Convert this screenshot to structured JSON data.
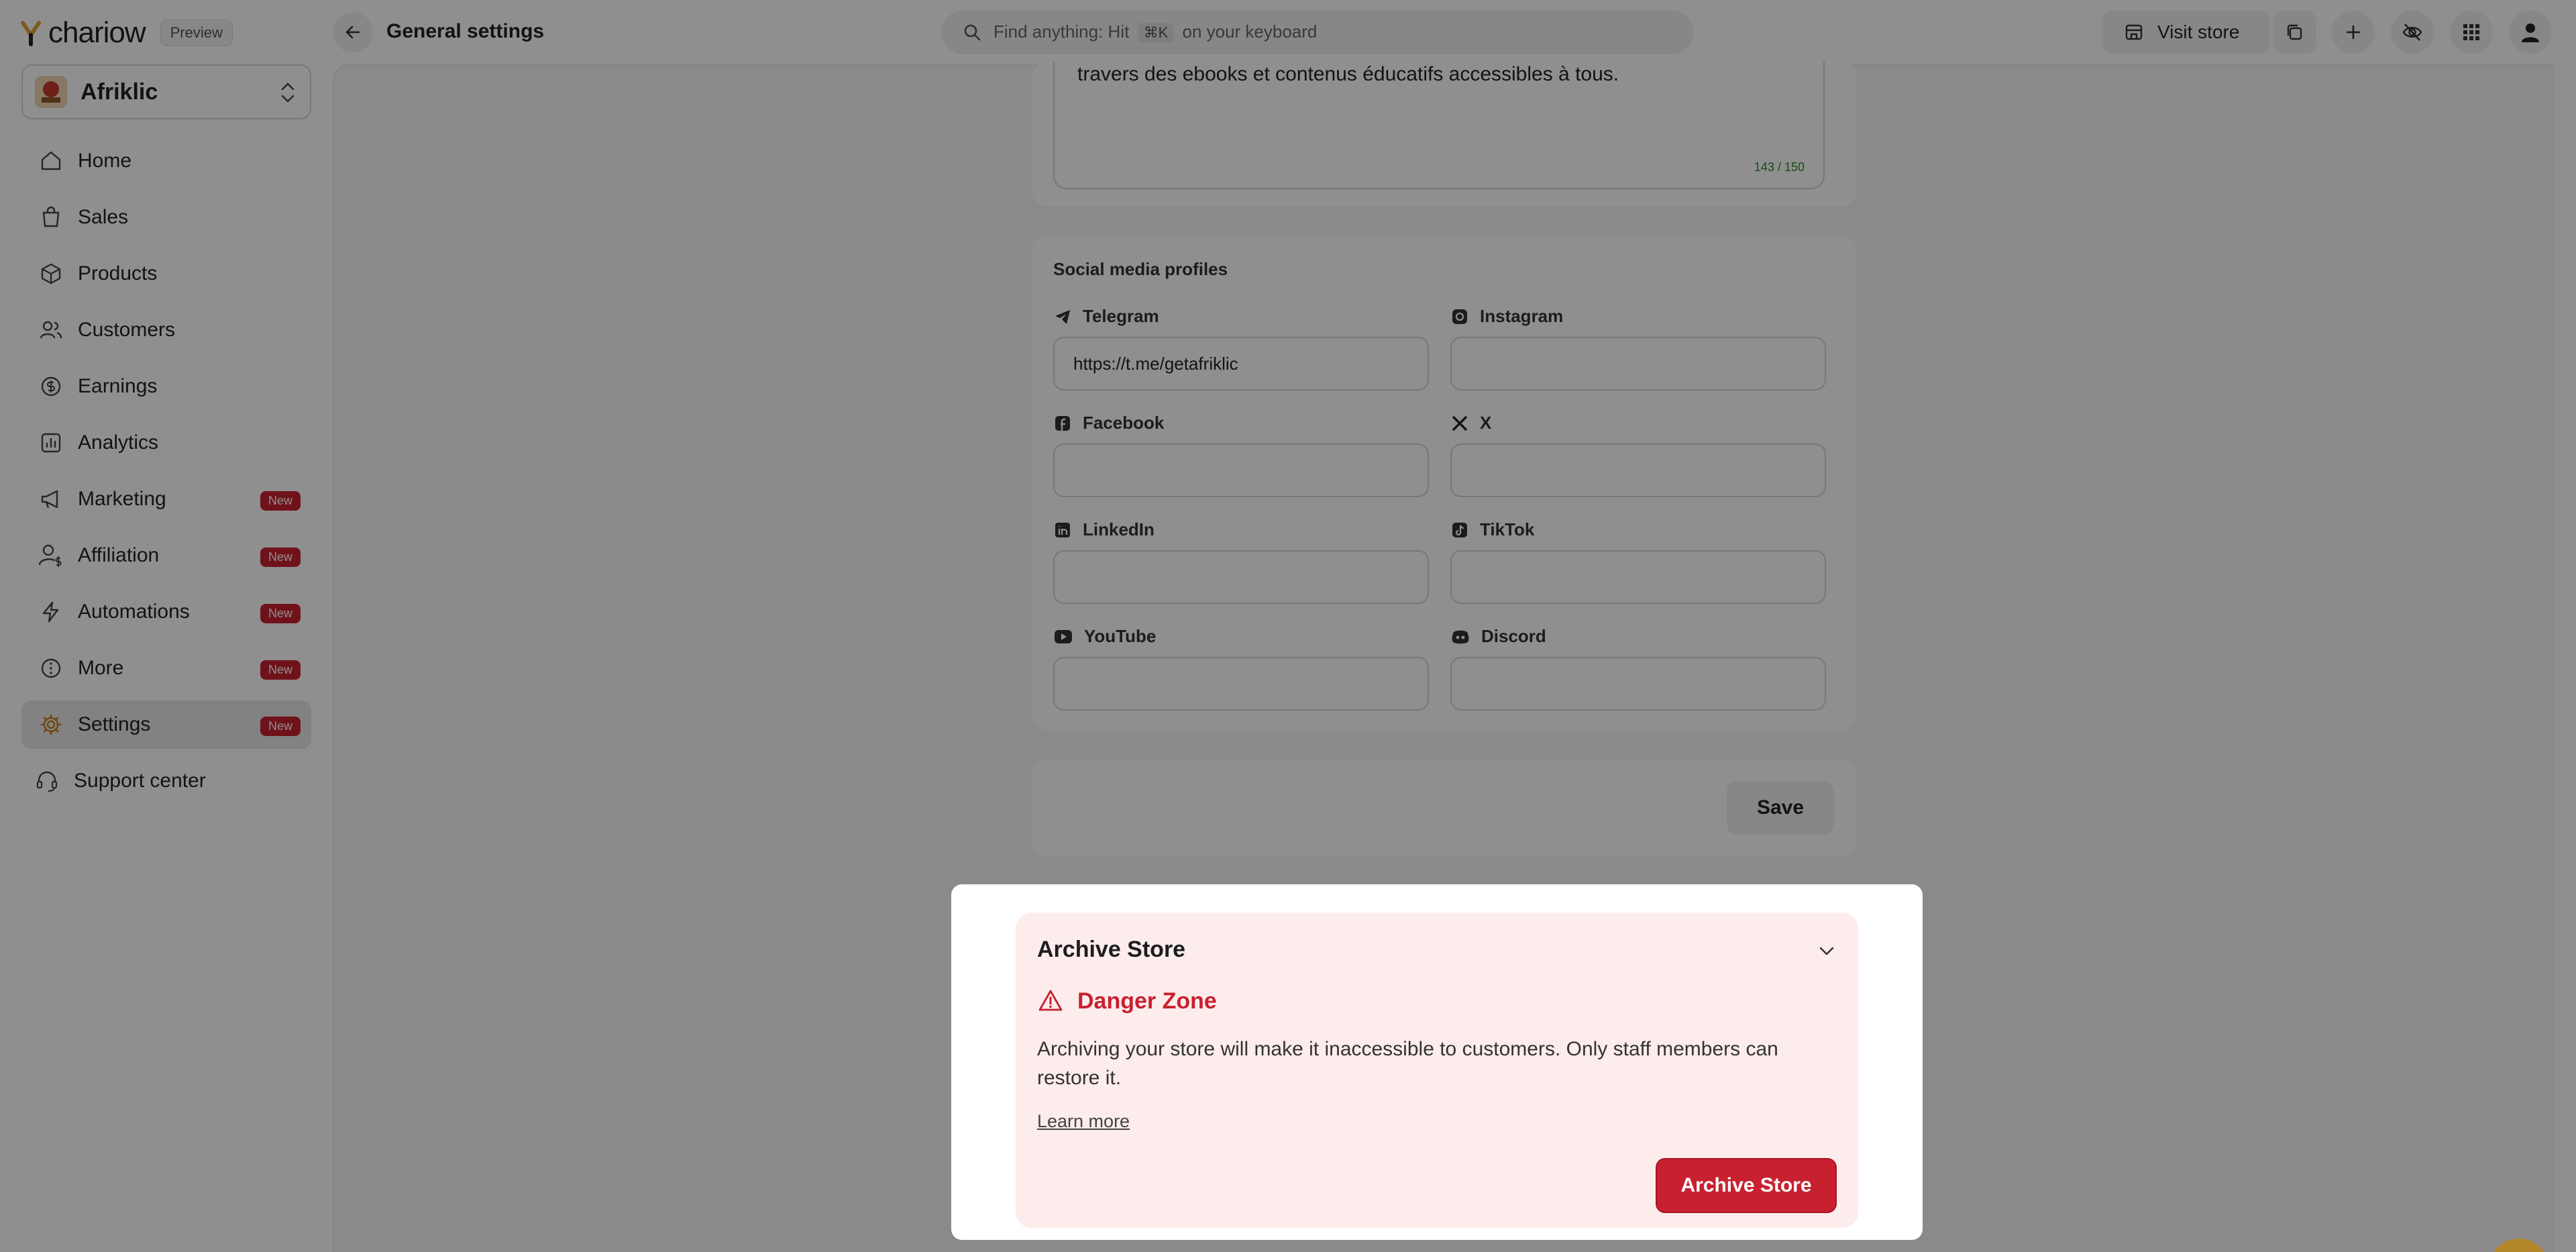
{
  "topbar": {
    "logo_text": "chariow",
    "preview_label": "Preview",
    "page_title": "General settings",
    "search": {
      "prefix": "Find anything: Hit",
      "shortcut": "⌘K",
      "suffix": "on your keyboard"
    },
    "visit_store_label": "Visit store"
  },
  "sidebar": {
    "store_name": "Afriklic",
    "nav": [
      {
        "label": "Home",
        "icon": "home-icon"
      },
      {
        "label": "Sales",
        "icon": "shopping-bag-icon"
      },
      {
        "label": "Products",
        "icon": "box-icon"
      },
      {
        "label": "Customers",
        "icon": "users-icon"
      },
      {
        "label": "Earnings",
        "icon": "coin-icon"
      },
      {
        "label": "Analytics",
        "icon": "chart-icon"
      },
      {
        "label": "Marketing",
        "icon": "megaphone-icon",
        "badge": "New"
      },
      {
        "label": "Affiliation",
        "icon": "user-dollar-icon",
        "badge": "New"
      },
      {
        "label": "Automations",
        "icon": "bolt-icon",
        "badge": "New"
      },
      {
        "label": "More",
        "icon": "more-icon",
        "badge": "New"
      },
      {
        "label": "Settings",
        "icon": "gear-icon",
        "badge": "New",
        "active": true
      },
      {
        "label": "Support center",
        "icon": "headset-icon"
      }
    ]
  },
  "description": {
    "text": "travers des ebooks et contenus éducatifs accessibles à tous.",
    "counter": "143 / 150"
  },
  "social": {
    "title": "Social media profiles",
    "fields": [
      {
        "label": "Telegram",
        "icon": "telegram-icon",
        "value": "https://t.me/getafriklic"
      },
      {
        "label": "Instagram",
        "icon": "instagram-icon",
        "value": ""
      },
      {
        "label": "Facebook",
        "icon": "facebook-icon",
        "value": ""
      },
      {
        "label": "X",
        "icon": "x-icon",
        "value": ""
      },
      {
        "label": "LinkedIn",
        "icon": "linkedin-icon",
        "value": ""
      },
      {
        "label": "TikTok",
        "icon": "tiktok-icon",
        "value": ""
      },
      {
        "label": "YouTube",
        "icon": "youtube-icon",
        "value": ""
      },
      {
        "label": "Discord",
        "icon": "discord-icon",
        "value": ""
      }
    ],
    "save_label": "Save"
  },
  "modal": {
    "title": "Archive Store",
    "danger_title": "Danger Zone",
    "danger_text": "Archiving your store will make it inaccessible to customers. Only staff members can restore it.",
    "learn_more": "Learn more",
    "archive_button": "Archive Store"
  },
  "colors": {
    "danger": "#c8202f",
    "danger_bg": "#fdecec",
    "active_nav": "#e8e8e8"
  }
}
